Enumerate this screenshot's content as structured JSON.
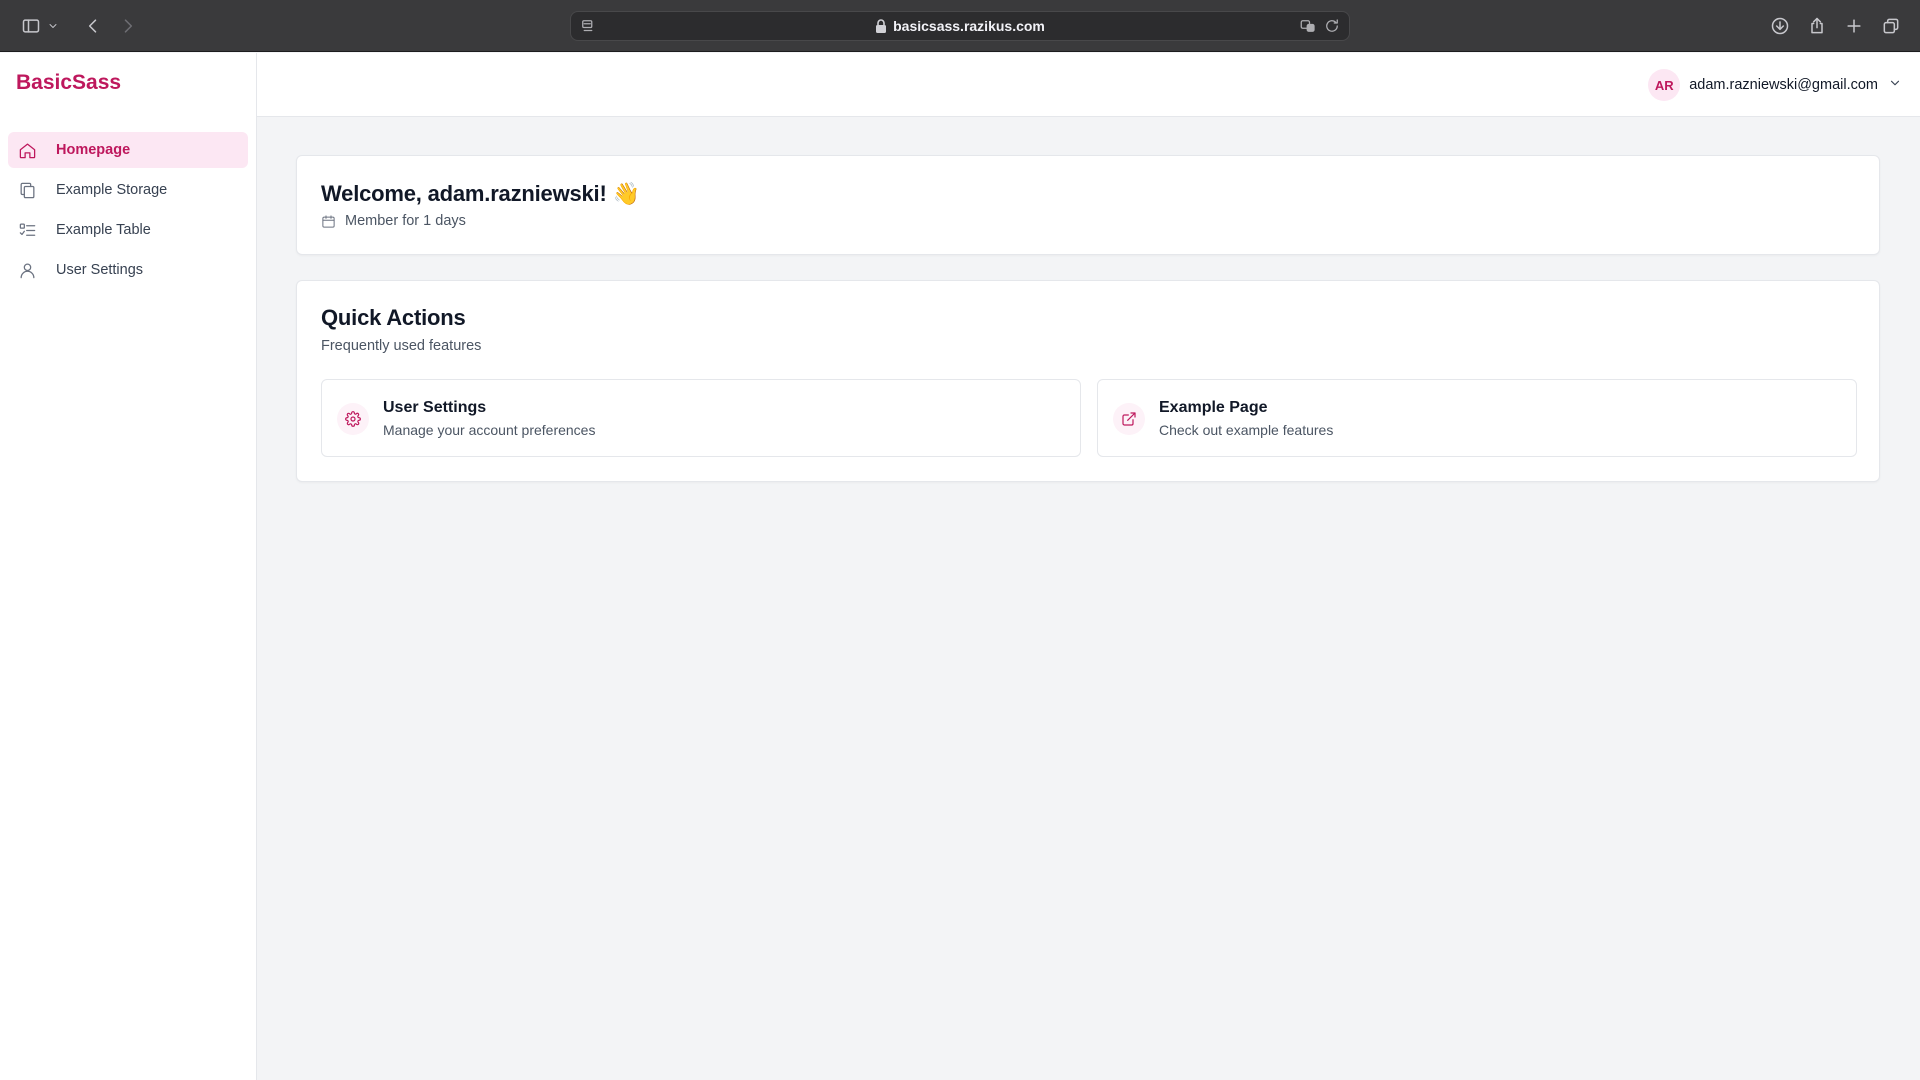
{
  "browser": {
    "url": "basicsass.razikus.com"
  },
  "brand": {
    "name": "BasicSass",
    "color": "#be185d"
  },
  "sidebar": {
    "items": [
      {
        "label": "Homepage",
        "icon": "home-icon",
        "active": true
      },
      {
        "label": "Example Storage",
        "icon": "files-icon",
        "active": false
      },
      {
        "label": "Example Table",
        "icon": "list-checks-icon",
        "active": false
      },
      {
        "label": "User Settings",
        "icon": "user-icon",
        "active": false
      }
    ]
  },
  "header": {
    "avatar_initials": "AR",
    "user_email": "adam.razniewski@gmail.com"
  },
  "welcome": {
    "title": "Welcome, adam.razniewski! 👋",
    "member_text": "Member for 1 days"
  },
  "quick_actions": {
    "title": "Quick Actions",
    "subtitle": "Frequently used features",
    "items": [
      {
        "title": "User Settings",
        "description": "Manage your account preferences",
        "icon": "gear-icon"
      },
      {
        "title": "Example Page",
        "description": "Check out example features",
        "icon": "external-link-icon"
      }
    ]
  }
}
